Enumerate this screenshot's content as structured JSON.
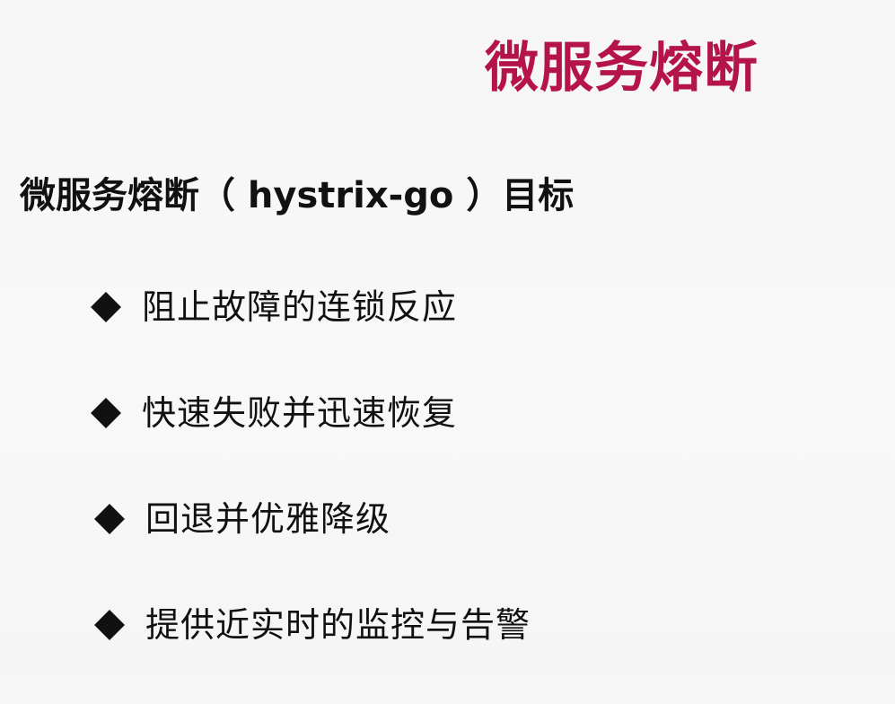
{
  "slide": {
    "title": "微服务熔断",
    "heading": "微服务熔断（ hystrix-go ）目标",
    "bullets": [
      {
        "text": "阻止故障的连锁反应",
        "marker": "diamond-icon"
      },
      {
        "text": "快速失败并迅速恢复",
        "marker": "diamond-icon"
      },
      {
        "text": "回退并优雅降级",
        "marker": "diamond-icon"
      },
      {
        "text": "提供近实时的监控与告警",
        "marker": "diamond-icon"
      }
    ],
    "colors": {
      "title": "#b5144b",
      "text": "#111111",
      "background": "#f7f7f7"
    }
  }
}
